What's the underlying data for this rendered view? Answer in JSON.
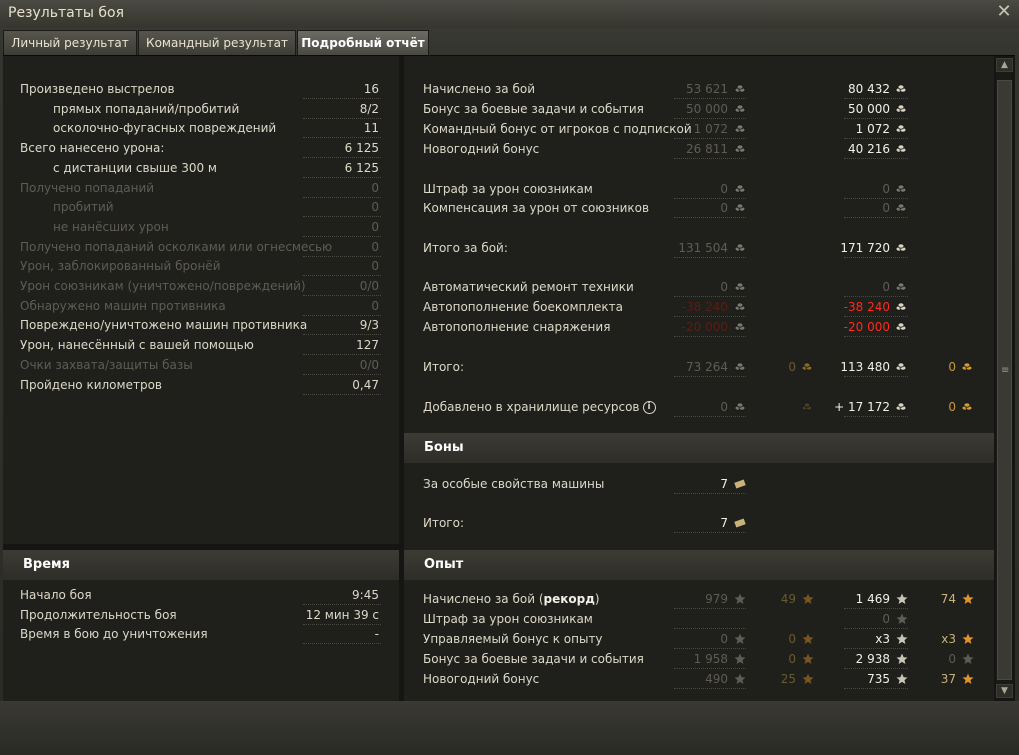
{
  "window": {
    "title": "Результаты боя"
  },
  "tabs": [
    {
      "label": "Личный результат"
    },
    {
      "label": "Командный результат"
    },
    {
      "label": "Подробный отчёт",
      "active": true
    }
  ],
  "stats": {
    "rows": [
      {
        "label": "Произведено выстрелов",
        "value": "16",
        "indent": false,
        "dim": false
      },
      {
        "label": "прямых попаданий/пробитий",
        "value": "8/2",
        "indent": true,
        "dim": false
      },
      {
        "label": "осколочно-фугасных повреждений",
        "value": "11",
        "indent": true,
        "dim": false
      },
      {
        "label": "Всего нанесено урона:",
        "value": "6 125",
        "indent": false,
        "dim": false
      },
      {
        "label": "с дистанции свыше 300 м",
        "value": "6 125",
        "indent": true,
        "dim": false
      },
      {
        "label": "Получено попаданий",
        "value": "0",
        "indent": false,
        "dim": true
      },
      {
        "label": "пробитий",
        "value": "0",
        "indent": true,
        "dim": true
      },
      {
        "label": "не нанёсших урон",
        "value": "0",
        "indent": true,
        "dim": true
      },
      {
        "label": "Получено попаданий осколками или огнесмесью",
        "value": "0",
        "indent": false,
        "dim": true
      },
      {
        "label": "Урон, заблокированный бронёй",
        "value": "0",
        "indent": false,
        "dim": true
      },
      {
        "label": "Урон союзникам (уничтожено/повреждений)",
        "value": "0/0",
        "indent": false,
        "dim": true
      },
      {
        "label": "Обнаружено машин противника",
        "value": "0",
        "indent": false,
        "dim": true
      },
      {
        "label": "Повреждено/уничтожено машин противника",
        "value": "9/3",
        "indent": false,
        "dim": false
      },
      {
        "label": "Урон, нанесённый с вашей помощью",
        "value": "127",
        "indent": false,
        "dim": false
      },
      {
        "label": "Очки захвата/защиты базы",
        "value": "0/0",
        "indent": false,
        "dim": true
      },
      {
        "label": "Пройдено километров",
        "value": "0,47",
        "indent": false,
        "dim": false
      }
    ]
  },
  "credits": {
    "rows": [
      {
        "label": "Начислено за бой",
        "base": "53 621",
        "prem": "80 432",
        "style": "normal"
      },
      {
        "label": "Бонус за боевые задачи и события",
        "base": "50 000",
        "prem": "50 000",
        "style": "normal"
      },
      {
        "label": "Командный бонус от игроков с подпиской",
        "base": "1 072",
        "prem": "1 072",
        "style": "normal"
      },
      {
        "label": "Новогодний бонус",
        "base": "26 811",
        "prem": "40 216",
        "style": "normal"
      },
      {
        "label": "Штраф за урон союзникам",
        "base": "0",
        "prem": "0",
        "style": "zero"
      },
      {
        "label": "Компенсация за урон от союзников",
        "base": "0",
        "prem": "0",
        "style": "zero"
      },
      {
        "label": "Итого за бой:",
        "base": "131 504",
        "prem": "171 720",
        "style": "normal"
      },
      {
        "label": "Автоматический ремонт техники",
        "base": "0",
        "prem": "0",
        "style": "zero"
      },
      {
        "label": "Автопополнение боекомплекта",
        "base": "-38 240",
        "prem": "-38 240",
        "style": "red"
      },
      {
        "label": "Автопополнение снаряжения",
        "base": "-20 000",
        "prem": "-20 000",
        "style": "red"
      },
      {
        "label": "Итого:",
        "base": "73 264",
        "base_gold": "0",
        "prem": "113 480",
        "prem_gold": "0",
        "style": "normal"
      },
      {
        "label": "Добавлено в хранилище ресурсов",
        "base": "0",
        "prem": "+ 17 172",
        "prem_gold": "0",
        "style": "store",
        "info_icon": "info-icon"
      }
    ]
  },
  "bonds": {
    "title": "Боны",
    "rows": [
      {
        "label": "За особые свойства машины",
        "value": "7"
      },
      {
        "label": "Итого:",
        "value": "7"
      }
    ]
  },
  "time": {
    "title": "Время",
    "rows": [
      {
        "label": "Начало боя",
        "value": "9:45",
        "dim": false
      },
      {
        "label": "Продолжительность боя",
        "value": "12 мин 39 с",
        "dim": false
      },
      {
        "label": "Время в бою до уничтожения",
        "value": "-",
        "dim": false
      }
    ]
  },
  "experience": {
    "title": "Опыт",
    "rows": [
      {
        "label": "Начислено за бой (",
        "label_bold": "рекорд",
        "label_end": ")",
        "base": "979",
        "base_free": "49",
        "prem": "1 469",
        "prem_free": "74"
      },
      {
        "label": "Штраф за урон союзникам",
        "base": "",
        "base_free": "",
        "prem": "0",
        "prem_free": ""
      },
      {
        "label": "Управляемый бонус к опыту",
        "base": "0",
        "base_free": "0",
        "prem": "x3",
        "prem_free": "x3"
      },
      {
        "label": "Бонус за боевые задачи и события",
        "base": "1 958",
        "base_free": "0",
        "prem": "2 938",
        "prem_free": "0"
      },
      {
        "label": "Новогодний бонус",
        "base": "490",
        "base_free": "25",
        "prem": "735",
        "prem_free": "37"
      }
    ]
  },
  "colors": {
    "credit_icon": "#d8d4c0",
    "xp_star": "#c9c6b8",
    "free_xp_star": "#e2902a",
    "red_value": "#ff2a1a",
    "gold_coin": "#d49a2a",
    "bond_ticket": "#c9b27a"
  }
}
